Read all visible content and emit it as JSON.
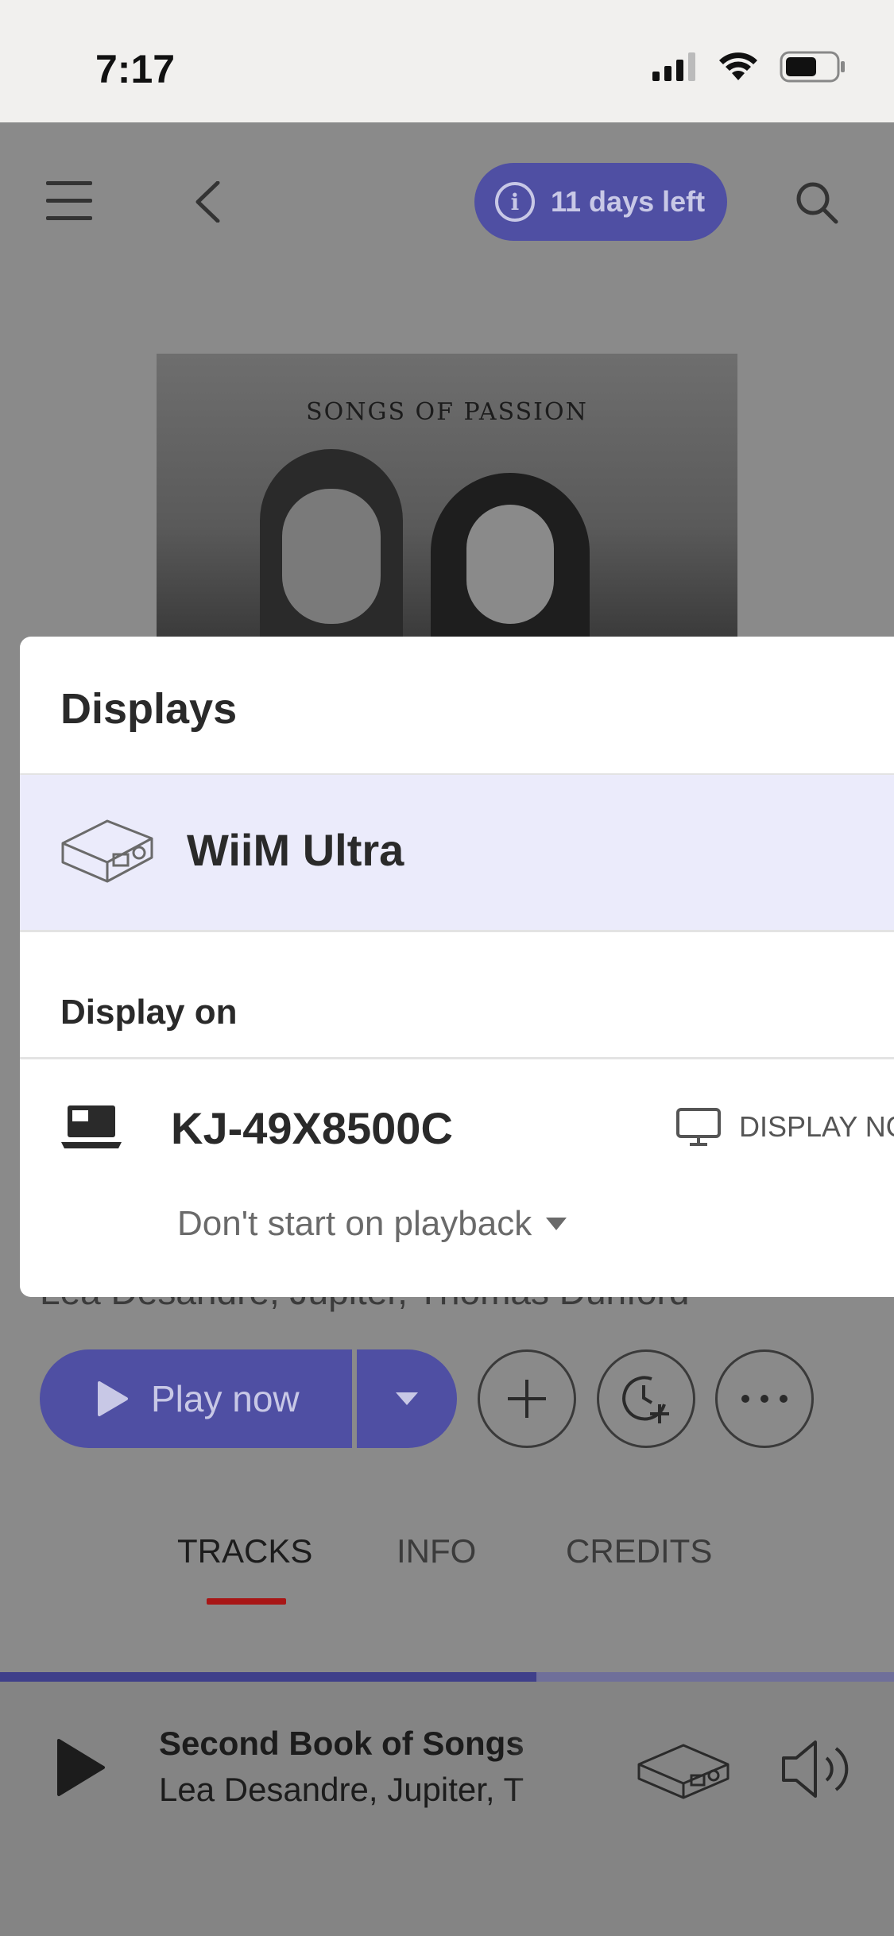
{
  "status_bar": {
    "time": "7:17"
  },
  "header": {
    "trial_badge": "11 days left",
    "icons": [
      "menu-icon",
      "back-icon",
      "info-icon",
      "search-icon"
    ]
  },
  "album": {
    "cover_title": "SONGS OF PASSION",
    "artists_partial": "Lea Desandre, Jupiter, Thomas Dunford"
  },
  "actions": {
    "play_label": "Play now"
  },
  "tabs": [
    {
      "label": "TRACKS",
      "active": true
    },
    {
      "label": "INFO",
      "active": false
    },
    {
      "label": "CREDITS",
      "active": false
    }
  ],
  "player": {
    "title": "Second Book of Songs",
    "artists": "Lea Desandre, Jupiter, T",
    "progress": 0.6
  },
  "sheet": {
    "title": "Displays",
    "device": "WiiM Ultra",
    "section_label": "Display on",
    "display_device": "KJ-49X8500C",
    "display_now_label": "DISPLAY NO",
    "start_option": "Don't start on playback"
  },
  "colors": {
    "accent": "#4f4fa3",
    "selected_row": "#ebebfb",
    "tab_underline": "#a81616",
    "overlay": "#8a8a8a"
  }
}
